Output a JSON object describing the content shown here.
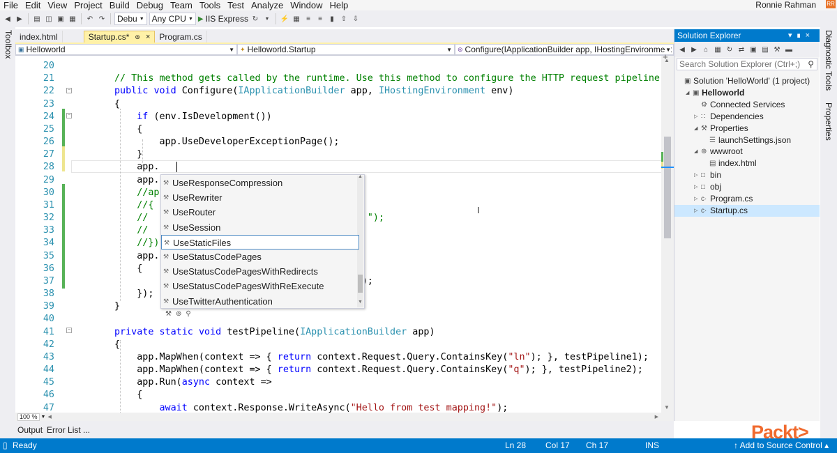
{
  "menu": {
    "items": [
      "File",
      "Edit",
      "View",
      "Project",
      "Build",
      "Debug",
      "Team",
      "Tools",
      "Test",
      "Analyze",
      "Window",
      "Help"
    ],
    "user": "Ronnie Rahman",
    "user_badge": "RR"
  },
  "toolbar": {
    "configuration": "Debu",
    "platform": "Any CPU",
    "run_target": "IIS Express"
  },
  "left_strip": {
    "label": "Toolbox"
  },
  "right_strip": {
    "labels": [
      "Diagnostic Tools",
      "Properties"
    ]
  },
  "tabs": [
    {
      "label": "index.html",
      "active": false
    },
    {
      "label": "Startup.cs*",
      "active": true,
      "pin": "⊚",
      "close": "×"
    },
    {
      "label": "Program.cs",
      "active": false
    }
  ],
  "navbar": {
    "project": "Helloworld",
    "type": "Helloworld.Startup",
    "member": "Configure(IApplicationBuilder app, IHostingEnvironment env)"
  },
  "editor": {
    "lines": [
      {
        "n": "20",
        "parts": []
      },
      {
        "n": "21",
        "parts": [
          [
            "cm",
            "// This method gets called by the runtime. Use this method to configure the HTTP request pipeline"
          ]
        ]
      },
      {
        "n": "22",
        "parts": [
          [
            "kw",
            "public"
          ],
          [
            "",
            " "
          ],
          [
            "kw",
            "void"
          ],
          [
            "",
            " Configure("
          ],
          [
            "ty",
            "IApplicationBuilder"
          ],
          [
            "",
            " app, "
          ],
          [
            "ty",
            "IHostingEnvironment"
          ],
          [
            "",
            " env)"
          ]
        ]
      },
      {
        "n": "23",
        "parts": [
          [
            "",
            "{"
          ]
        ]
      },
      {
        "n": "24",
        "parts": [
          [
            "",
            "    "
          ],
          [
            "kw",
            "if"
          ],
          [
            "",
            " (env.IsDevelopment())"
          ]
        ]
      },
      {
        "n": "25",
        "parts": [
          [
            "",
            "    {"
          ]
        ]
      },
      {
        "n": "26",
        "parts": [
          [
            "",
            "        app.UseDeveloperExceptionPage();"
          ]
        ]
      },
      {
        "n": "27",
        "parts": [
          [
            "",
            "    }"
          ]
        ]
      },
      {
        "n": "28",
        "parts": [
          [
            "",
            "    app."
          ]
        ]
      },
      {
        "n": "29",
        "parts": [
          [
            "",
            "    app."
          ]
        ]
      },
      {
        "n": "30",
        "parts": [
          [
            "cm",
            "    //ap"
          ]
        ]
      },
      {
        "n": "31",
        "parts": [
          [
            "cm",
            "    //{"
          ]
        ]
      },
      {
        "n": "32",
        "parts": [
          [
            "cm",
            "    //"
          ],
          [
            "",
            "                        "
          ],
          [
            "cm",
            "\"Before Hello: \");"
          ]
        ]
      },
      {
        "n": "33",
        "parts": [
          [
            "cm",
            "    //"
          ]
        ]
      },
      {
        "n": "34",
        "parts": [
          [
            "cm",
            "    //})"
          ]
        ]
      },
      {
        "n": "35",
        "parts": [
          [
            "",
            "    app."
          ]
        ]
      },
      {
        "n": "36",
        "parts": [
          [
            "",
            "    {"
          ]
        ]
      },
      {
        "n": "37",
        "parts": [
          [
            "",
            "                                "
          ],
          [
            "st",
            "ello world!\""
          ],
          [
            "",
            ");"
          ]
        ]
      },
      {
        "n": "38",
        "parts": [
          [
            "",
            "    });"
          ]
        ]
      },
      {
        "n": "39",
        "parts": [
          [
            "",
            "}"
          ]
        ]
      },
      {
        "n": "40",
        "parts": []
      },
      {
        "n": "41",
        "parts": [
          [
            "kw",
            "private"
          ],
          [
            "",
            " "
          ],
          [
            "kw",
            "static"
          ],
          [
            "",
            " "
          ],
          [
            "kw",
            "void"
          ],
          [
            "",
            " testPipeline("
          ],
          [
            "ty",
            "IApplicationBuilder"
          ],
          [
            "",
            " app)"
          ]
        ]
      },
      {
        "n": "42",
        "parts": [
          [
            "",
            "{"
          ]
        ]
      },
      {
        "n": "43",
        "parts": [
          [
            "",
            "    app.MapWhen(context => { "
          ],
          [
            "kw",
            "return"
          ],
          [
            "",
            " context.Request.Query.ContainsKey("
          ],
          [
            "st",
            "\"ln\""
          ],
          [
            "",
            "); }, testPipeline1);"
          ]
        ]
      },
      {
        "n": "44",
        "parts": [
          [
            "",
            "    app.MapWhen(context => { "
          ],
          [
            "kw",
            "return"
          ],
          [
            "",
            " context.Request.Query.ContainsKey("
          ],
          [
            "st",
            "\"q\""
          ],
          [
            "",
            "); }, testPipeline2);"
          ]
        ]
      },
      {
        "n": "45",
        "parts": [
          [
            "",
            "    app.Run("
          ],
          [
            "kw",
            "async"
          ],
          [
            "",
            " context =>"
          ]
        ]
      },
      {
        "n": "46",
        "parts": [
          [
            "",
            "    {"
          ]
        ]
      },
      {
        "n": "47",
        "parts": [
          [
            "",
            "        "
          ],
          [
            "kw",
            "await"
          ],
          [
            "",
            " context.Response.WriteAsync("
          ],
          [
            "st",
            "\"Hello from test mapping!\""
          ],
          [
            "",
            ");"
          ]
        ]
      }
    ]
  },
  "intellisense": {
    "items": [
      "UseResponseCompression",
      "UseRewriter",
      "UseRouter",
      "UseSession",
      "UseStaticFiles",
      "UseStatusCodePages",
      "UseStatusCodePagesWithRedirects",
      "UseStatusCodePagesWithReExecute",
      "UseTwitterAuthentication"
    ],
    "selected_index": 4
  },
  "zoom": "100 %",
  "solution_explorer": {
    "title": "Solution Explorer",
    "search_placeholder": "Search Solution Explorer (Ctrl+;)",
    "nodes": [
      {
        "label": "Solution 'HelloWorld' (1 project)",
        "depth": 0,
        "twist": "",
        "icon": "▣",
        "bold": false,
        "selected": false
      },
      {
        "label": "Helloworld",
        "depth": 1,
        "twist": "◢",
        "icon": "▣",
        "bold": true,
        "selected": false
      },
      {
        "label": "Connected Services",
        "depth": 2,
        "twist": "",
        "icon": "⚙",
        "bold": false,
        "selected": false
      },
      {
        "label": "Dependencies",
        "depth": 2,
        "twist": "▷",
        "icon": "∷",
        "bold": false,
        "selected": false
      },
      {
        "label": "Properties",
        "depth": 2,
        "twist": "◢",
        "icon": "⚒",
        "bold": false,
        "selected": false
      },
      {
        "label": "launchSettings.json",
        "depth": 3,
        "twist": "",
        "icon": "☰",
        "bold": false,
        "selected": false
      },
      {
        "label": "wwwroot",
        "depth": 2,
        "twist": "◢",
        "icon": "⊕",
        "bold": false,
        "selected": false
      },
      {
        "label": "index.html",
        "depth": 3,
        "twist": "",
        "icon": "▤",
        "bold": false,
        "selected": false
      },
      {
        "label": "bin",
        "depth": 2,
        "twist": "▷",
        "icon": "□",
        "bold": false,
        "selected": false
      },
      {
        "label": "obj",
        "depth": 2,
        "twist": "▷",
        "icon": "□",
        "bold": false,
        "selected": false
      },
      {
        "label": "Program.cs",
        "depth": 2,
        "twist": "▷",
        "icon": "c·",
        "bold": false,
        "selected": false
      },
      {
        "label": "Startup.cs",
        "depth": 2,
        "twist": "▷",
        "icon": "c·",
        "bold": false,
        "selected": true
      }
    ]
  },
  "output_tabs": [
    "Output",
    "Error List ..."
  ],
  "status": {
    "state": "Ready",
    "line": "Ln 28",
    "col": "Col 17",
    "ch": "Ch 17",
    "mode": "INS",
    "source_control": "↑ Add to Source Control ▴"
  },
  "branding": {
    "logo_text": "Packt>"
  },
  "colors": {
    "accent": "#007acc",
    "active_tab": "#fff1a8",
    "keyword": "#0000ff",
    "type": "#2b91af",
    "comment": "#008000",
    "string": "#a31515",
    "logo": "#f06a2e"
  }
}
